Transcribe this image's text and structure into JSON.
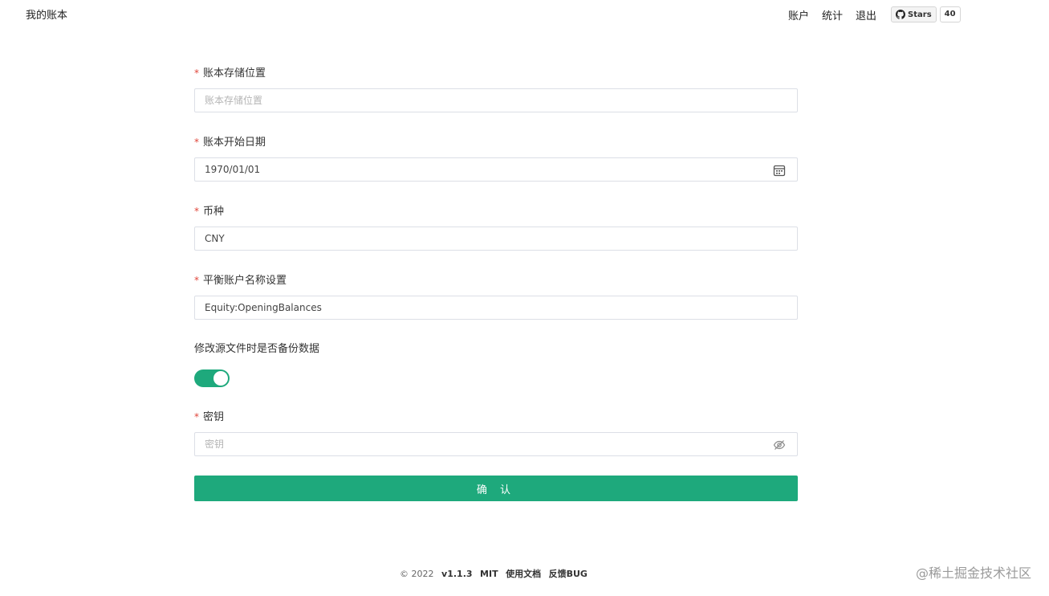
{
  "app": {
    "title": "我的账本"
  },
  "nav": {
    "items": [
      "账户",
      "统计",
      "退出"
    ],
    "github": {
      "stars_label": "Stars",
      "stars_count": "40"
    }
  },
  "form": {
    "storage": {
      "label": "账本存储位置",
      "required": "*",
      "value": "",
      "placeholder": "账本存储位置"
    },
    "start_date": {
      "label": "账本开始日期",
      "required": "*",
      "value": "1970/01/01",
      "icon": "calendar-icon"
    },
    "currency": {
      "label": "币种",
      "required": "*",
      "value": "CNY"
    },
    "balance_account": {
      "label": "平衡账户名称设置",
      "required": "*",
      "value": "Equity:OpeningBalances"
    },
    "backup": {
      "label": "修改源文件时是否备份数据",
      "enabled": true
    },
    "secret": {
      "label": "密钥",
      "required": "*",
      "value": "",
      "placeholder": "密钥",
      "icon": "eye-off-icon"
    },
    "submit_label": "确 认"
  },
  "footer": {
    "copyright": "© 2022",
    "version": "v1.1.3",
    "license": "MIT",
    "docs": "使用文档",
    "feedback": "反馈BUG"
  },
  "watermark": "@稀土掘金技术社区",
  "colors": {
    "accent": "#1ea97c",
    "required": "#e0453a",
    "border": "#dcdfe6"
  }
}
